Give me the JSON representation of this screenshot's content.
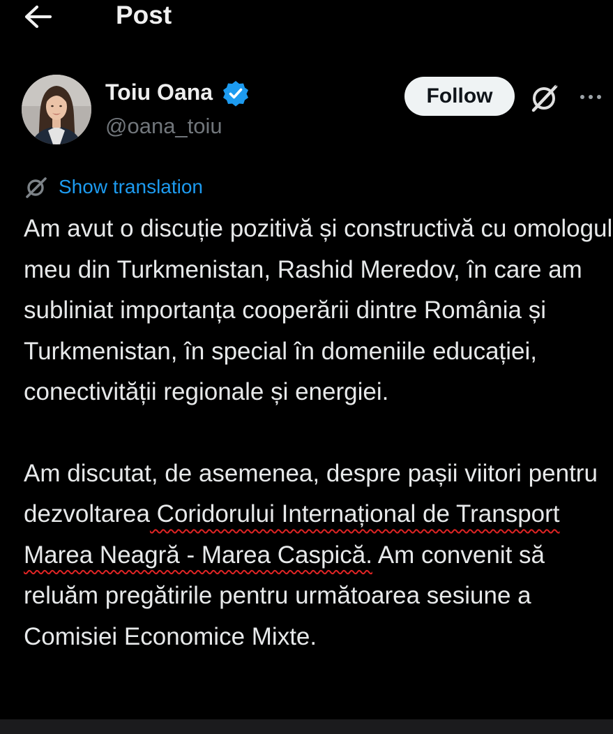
{
  "header": {
    "back_icon": "arrow-left-icon",
    "title": "Post"
  },
  "author": {
    "name": "Toiu Oana",
    "handle": "@oana_toiu",
    "verified_icon": "verified-badge-icon",
    "verified_color": "#1d9bf0",
    "follow_label": "Follow",
    "grok_icon": "grok-icon",
    "more_icon": "more-options-icon"
  },
  "translation": {
    "icon": "grok-icon",
    "label": "Show translation",
    "color": "#1d9bf0"
  },
  "post": {
    "paragraph1": "Am avut o discuție pozitivă și constructivă cu omologul meu din Turkmenistan, Rashid Meredov, în care am subliniat importanța cooperării dintre România și Turkmenistan, în special în domeniile educației, conectivității regionale și energiei.",
    "paragraph2_before": "Am discutat, de asemenea, despre pașii viitori pentru dezvoltarea",
    "paragraph2_highlight": " Coridorului Internațional de Transport Marea Neagră - Marea Caspică.",
    "paragraph2_after": " Am convenit să reluăm pregătirile pentru următoarea sesiune a Comisiei Economice Mixte.",
    "annotation_color": "#e02424"
  },
  "colors": {
    "background": "#000000",
    "text": "#e7e9ea",
    "muted": "#71767b",
    "accent": "#1d9bf0",
    "follow_bg": "#eff3f4"
  }
}
